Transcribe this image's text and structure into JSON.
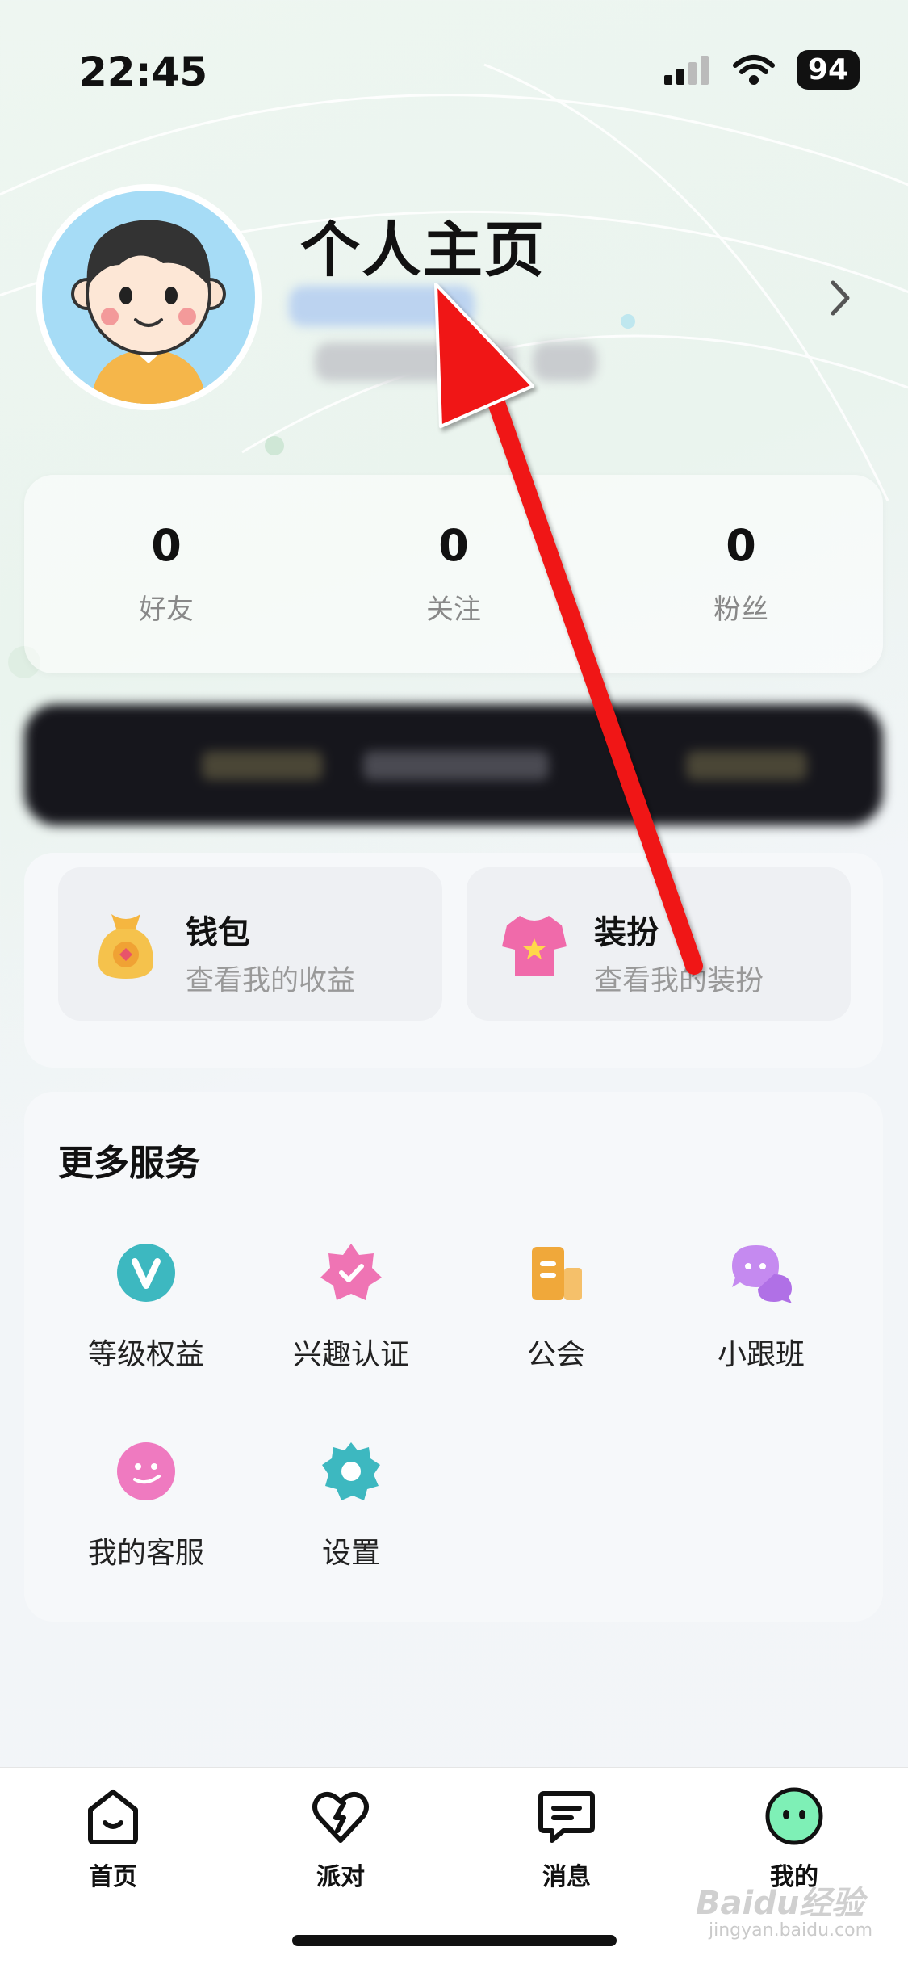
{
  "status_bar": {
    "time": "22:45",
    "battery": "94"
  },
  "profile": {
    "title": "个人主页"
  },
  "stats": [
    {
      "value": "0",
      "label": "好友"
    },
    {
      "value": "0",
      "label": "关注"
    },
    {
      "value": "0",
      "label": "粉丝"
    }
  ],
  "wallet": {
    "title": "钱包",
    "subtitle": "查看我的收益"
  },
  "outfit": {
    "title": "装扮",
    "subtitle": "查看我的装扮"
  },
  "services": {
    "title": "更多服务",
    "items": [
      {
        "label": "等级权益",
        "icon": "vip-level-icon"
      },
      {
        "label": "兴趣认证",
        "icon": "interest-badge-icon"
      },
      {
        "label": "公会",
        "icon": "guild-icon"
      },
      {
        "label": "小跟班",
        "icon": "chat-bubbles-icon"
      },
      {
        "label": "我的客服",
        "icon": "customer-service-icon"
      },
      {
        "label": "设置",
        "icon": "settings-gear-icon"
      }
    ]
  },
  "tabs": [
    {
      "label": "首页",
      "icon": "home-icon"
    },
    {
      "label": "派对",
      "icon": "heart-bolt-icon"
    },
    {
      "label": "消息",
      "icon": "message-icon"
    },
    {
      "label": "我的",
      "icon": "face-icon",
      "active": true
    }
  ],
  "watermark": {
    "text": "Baidu经验",
    "sub": "jingyan.baidu.com"
  },
  "colors": {
    "arrow": "#f01414",
    "teal": "#3db8c0",
    "pink": "#ef74b4",
    "orange": "#f0a83a",
    "purple": "#c58af0"
  }
}
